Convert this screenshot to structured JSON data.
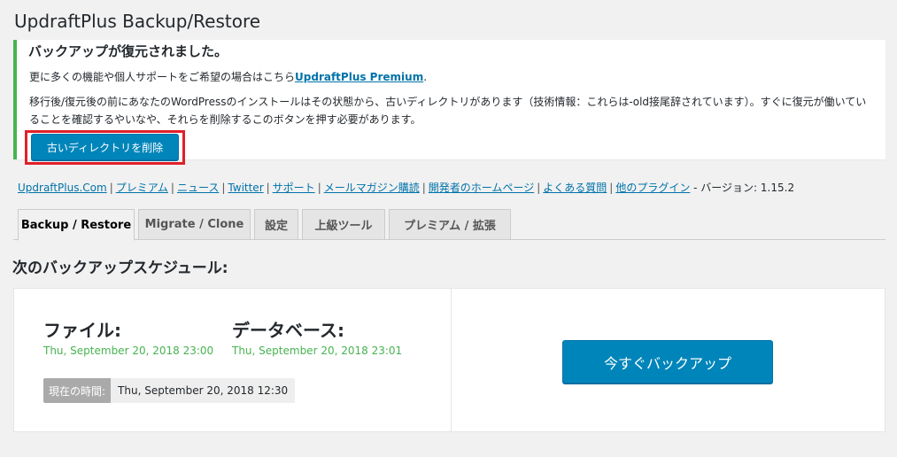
{
  "page": {
    "title": "UpdraftPlus Backup/Restore"
  },
  "notice": {
    "title": "バックアップが復元されました。",
    "line1_text": "更に多くの機能や個人サポートをご希望の場合はこちら",
    "line1_link": "UpdraftPlus Premium",
    "line1_end": ".",
    "line2": "移行後/復元後の前にあなたのWordPressのインストールはその状態から、古いディレクトリがあります（技術情報：これらは-old接尾辞されています）。すぐに復元が働いていることを確認するやいなや、それらを削除するこのボタンを押す必要があります。",
    "delete_button": "古いディレクトリを削除",
    "colors": {
      "success_border": "#46b450",
      "highlight": "#e0202a",
      "button": "#0085ba"
    }
  },
  "links": {
    "items": [
      "UpdraftPlus.Com",
      "プレミアム",
      "ニュース",
      "Twitter",
      "サポート",
      "メールマガジン購読",
      "開発者のホームページ",
      "よくある質問",
      "他のプラグイン"
    ],
    "version_text": "- バージョン: 1.15.2"
  },
  "tabs": [
    {
      "label": "Backup / Restore",
      "active": true
    },
    {
      "label": "Migrate / Clone",
      "active": false
    },
    {
      "label": "設定",
      "active": false
    },
    {
      "label": "上級ツール",
      "active": false
    },
    {
      "label": "プレミアム / 拡張",
      "active": false
    }
  ],
  "schedule": {
    "heading": "次のバックアップスケジュール:",
    "files_label": "ファイル:",
    "files_date": "Thu, September 20, 2018 23:00",
    "db_label": "データベース:",
    "db_date": "Thu, September 20, 2018 23:01",
    "current_time_label": "現在の時間:",
    "current_time_value": "Thu, September 20, 2018 12:30",
    "backup_now_button": "今すぐバックアップ"
  }
}
